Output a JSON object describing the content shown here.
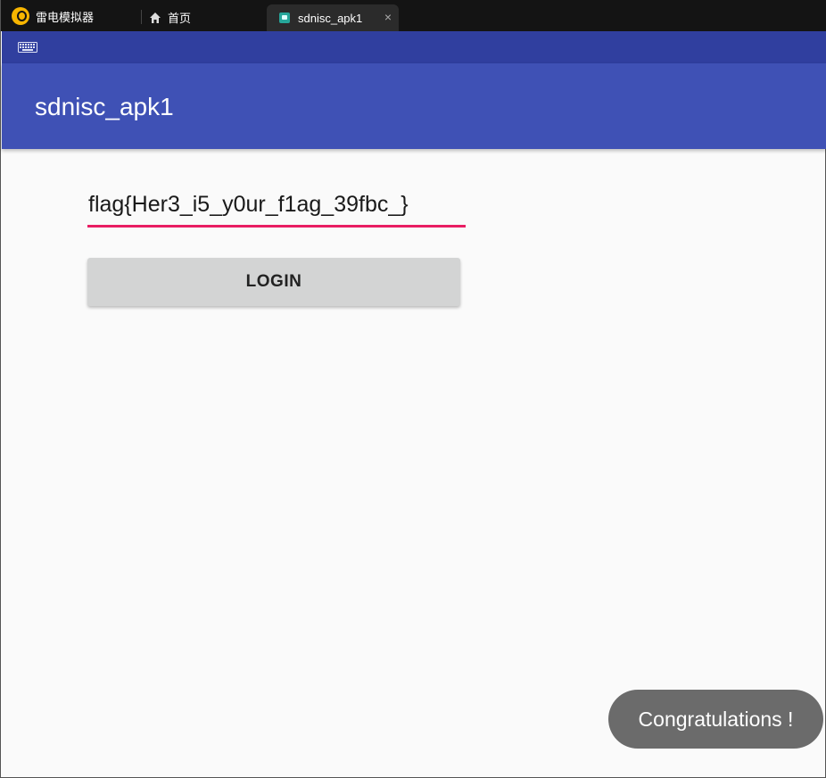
{
  "emulator": {
    "brand_name": "雷电模拟器",
    "home_tab_label": "首页",
    "active_tab_label": "sdnisc_apk1",
    "close_glyph": "×"
  },
  "appbar": {
    "title": "sdnisc_apk1",
    "color": "#3f51b5",
    "status_color": "#303f9f"
  },
  "form": {
    "flag_value": "flag{Her3_i5_y0ur_f1ag_39fbc_}",
    "login_label": "LOGIN",
    "accent_color": "#e91e63"
  },
  "toast": {
    "message": "Congratulations !"
  }
}
